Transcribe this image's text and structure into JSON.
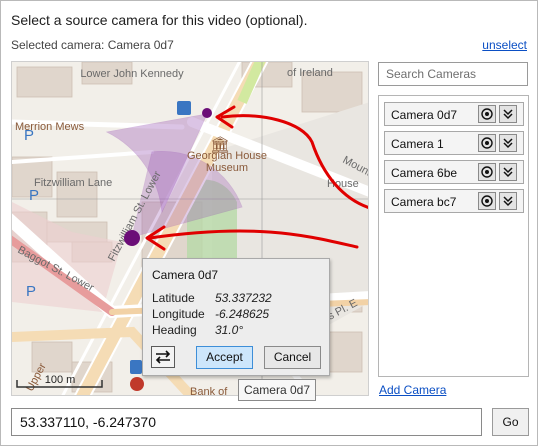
{
  "window": {
    "prompt": "Select a source camera for this video (optional).",
    "selected_camera": "Selected camera: Camera 0d7",
    "unselect_label": "unselect"
  },
  "search": {
    "placeholder": "Search Cameras",
    "value": ""
  },
  "cameras": [
    {
      "label": "Camera 0d7"
    },
    {
      "label": "Camera 1"
    },
    {
      "label": "Camera 6be"
    },
    {
      "label": "Camera bc7"
    }
  ],
  "add_camera_label": "Add Camera",
  "coordinates": {
    "value": "53.337110, -6.247370"
  },
  "go_label": "Go",
  "map": {
    "streets": {
      "john_kennedy": "Lower John Kennedy",
      "of_ireland": "of Ireland",
      "merrion_mews": "Merrion Mews",
      "fitzwilliam_lane": "Fitzwilliam Lane",
      "fitzwilliam_lower": "Fitzwilliam St. Lower",
      "baggot_lower": "Baggot St. Lower",
      "mount": "Mount",
      "house": "House",
      "pl_e": "s Pl. E",
      "upper": "Upper",
      "bank_of": "Bank of"
    },
    "poi": {
      "museum": "Georgian House Museum",
      "parking": "P"
    },
    "scale_label": "100 m",
    "colors": {
      "camera_marker": "#6b0d77",
      "view_cone": "#9b59b6",
      "arrow": "#e00000",
      "road_main": "#f5dcb5",
      "road_highlight": "#e79c9c"
    }
  },
  "popup": {
    "title": "Camera 0d7",
    "latitude_label": "Latitude",
    "latitude_value": "53.337232",
    "longitude_label": "Longitude",
    "longitude_value": "-6.248625",
    "heading_label": "Heading",
    "heading_value": "31.0°",
    "accept_label": "Accept",
    "cancel_label": "Cancel"
  },
  "tooltip": {
    "text": "Camera 0d7"
  }
}
